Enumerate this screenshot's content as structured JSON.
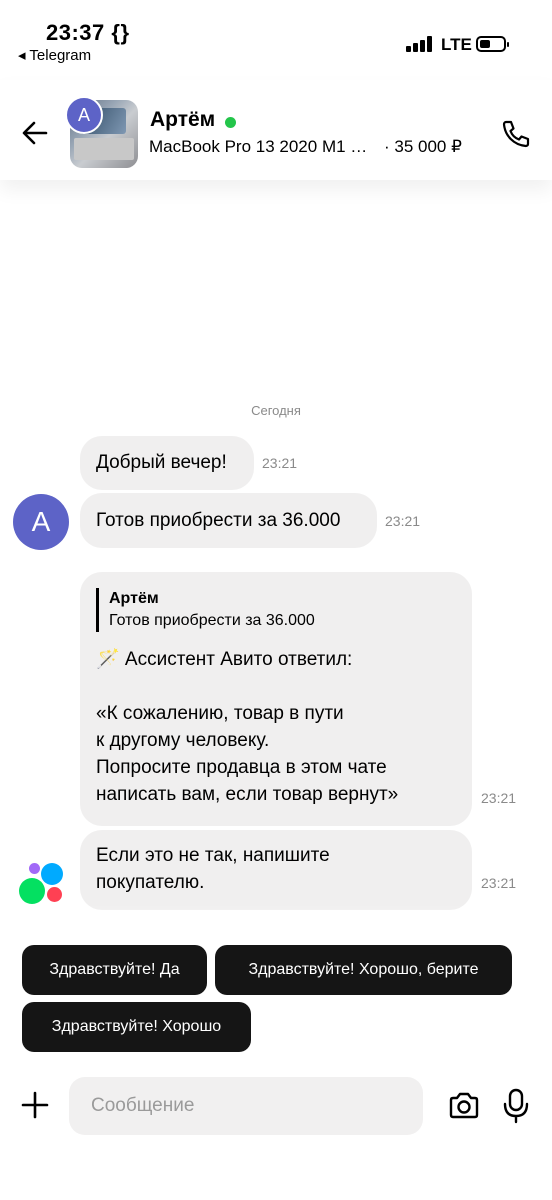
{
  "status_bar": {
    "time": "23:37",
    "time_badge": "{}",
    "back_app": "◂ Telegram",
    "network": "LTE"
  },
  "header": {
    "avatar_letter": "А",
    "name": "Артём",
    "online_color": "#23c54a",
    "item_title": "MacBook Pro 13 2020 M1 …",
    "item_price": "· 35 000 ₽",
    "icons": [
      "back-arrow-icon",
      "phone-icon"
    ]
  },
  "chat": {
    "date_label": "Сегодня",
    "buyer_avatar_letter": "А",
    "messages": [
      {
        "text": "Добрый вечер!",
        "time": "23:21"
      },
      {
        "text": "Готов приобрести за 36.000",
        "time": "23:21"
      },
      {
        "quote_author": "Артём",
        "quote_text": "Готов приобрести за 36.000",
        "lines": [
          "🪄 Ассистент Авито ответил:",
          "",
          "«К сожалению, товар в пути",
          "к другому человеку.",
          "Попросите продавца в этом чате",
          "написать вам, если товар вернут»"
        ],
        "time": "23:21"
      },
      {
        "lines": [
          "Если это не так, напишите",
          "покупателю."
        ],
        "time": "23:21"
      }
    ]
  },
  "quick_replies": [
    "Здравствуйте! Да",
    "Здравствуйте! Хорошо, берите",
    "Здравствуйте! Хорошо"
  ],
  "composer": {
    "placeholder": "Сообщение",
    "icons": [
      "plus-icon",
      "camera-icon",
      "microphone-icon"
    ]
  },
  "colors": {
    "avatar": "#5d63c7",
    "bubble": "#f0efef",
    "chip": "#151515",
    "avito_logo": [
      "#a169f7",
      "#0af",
      "#04e061",
      "#ff4053"
    ]
  }
}
